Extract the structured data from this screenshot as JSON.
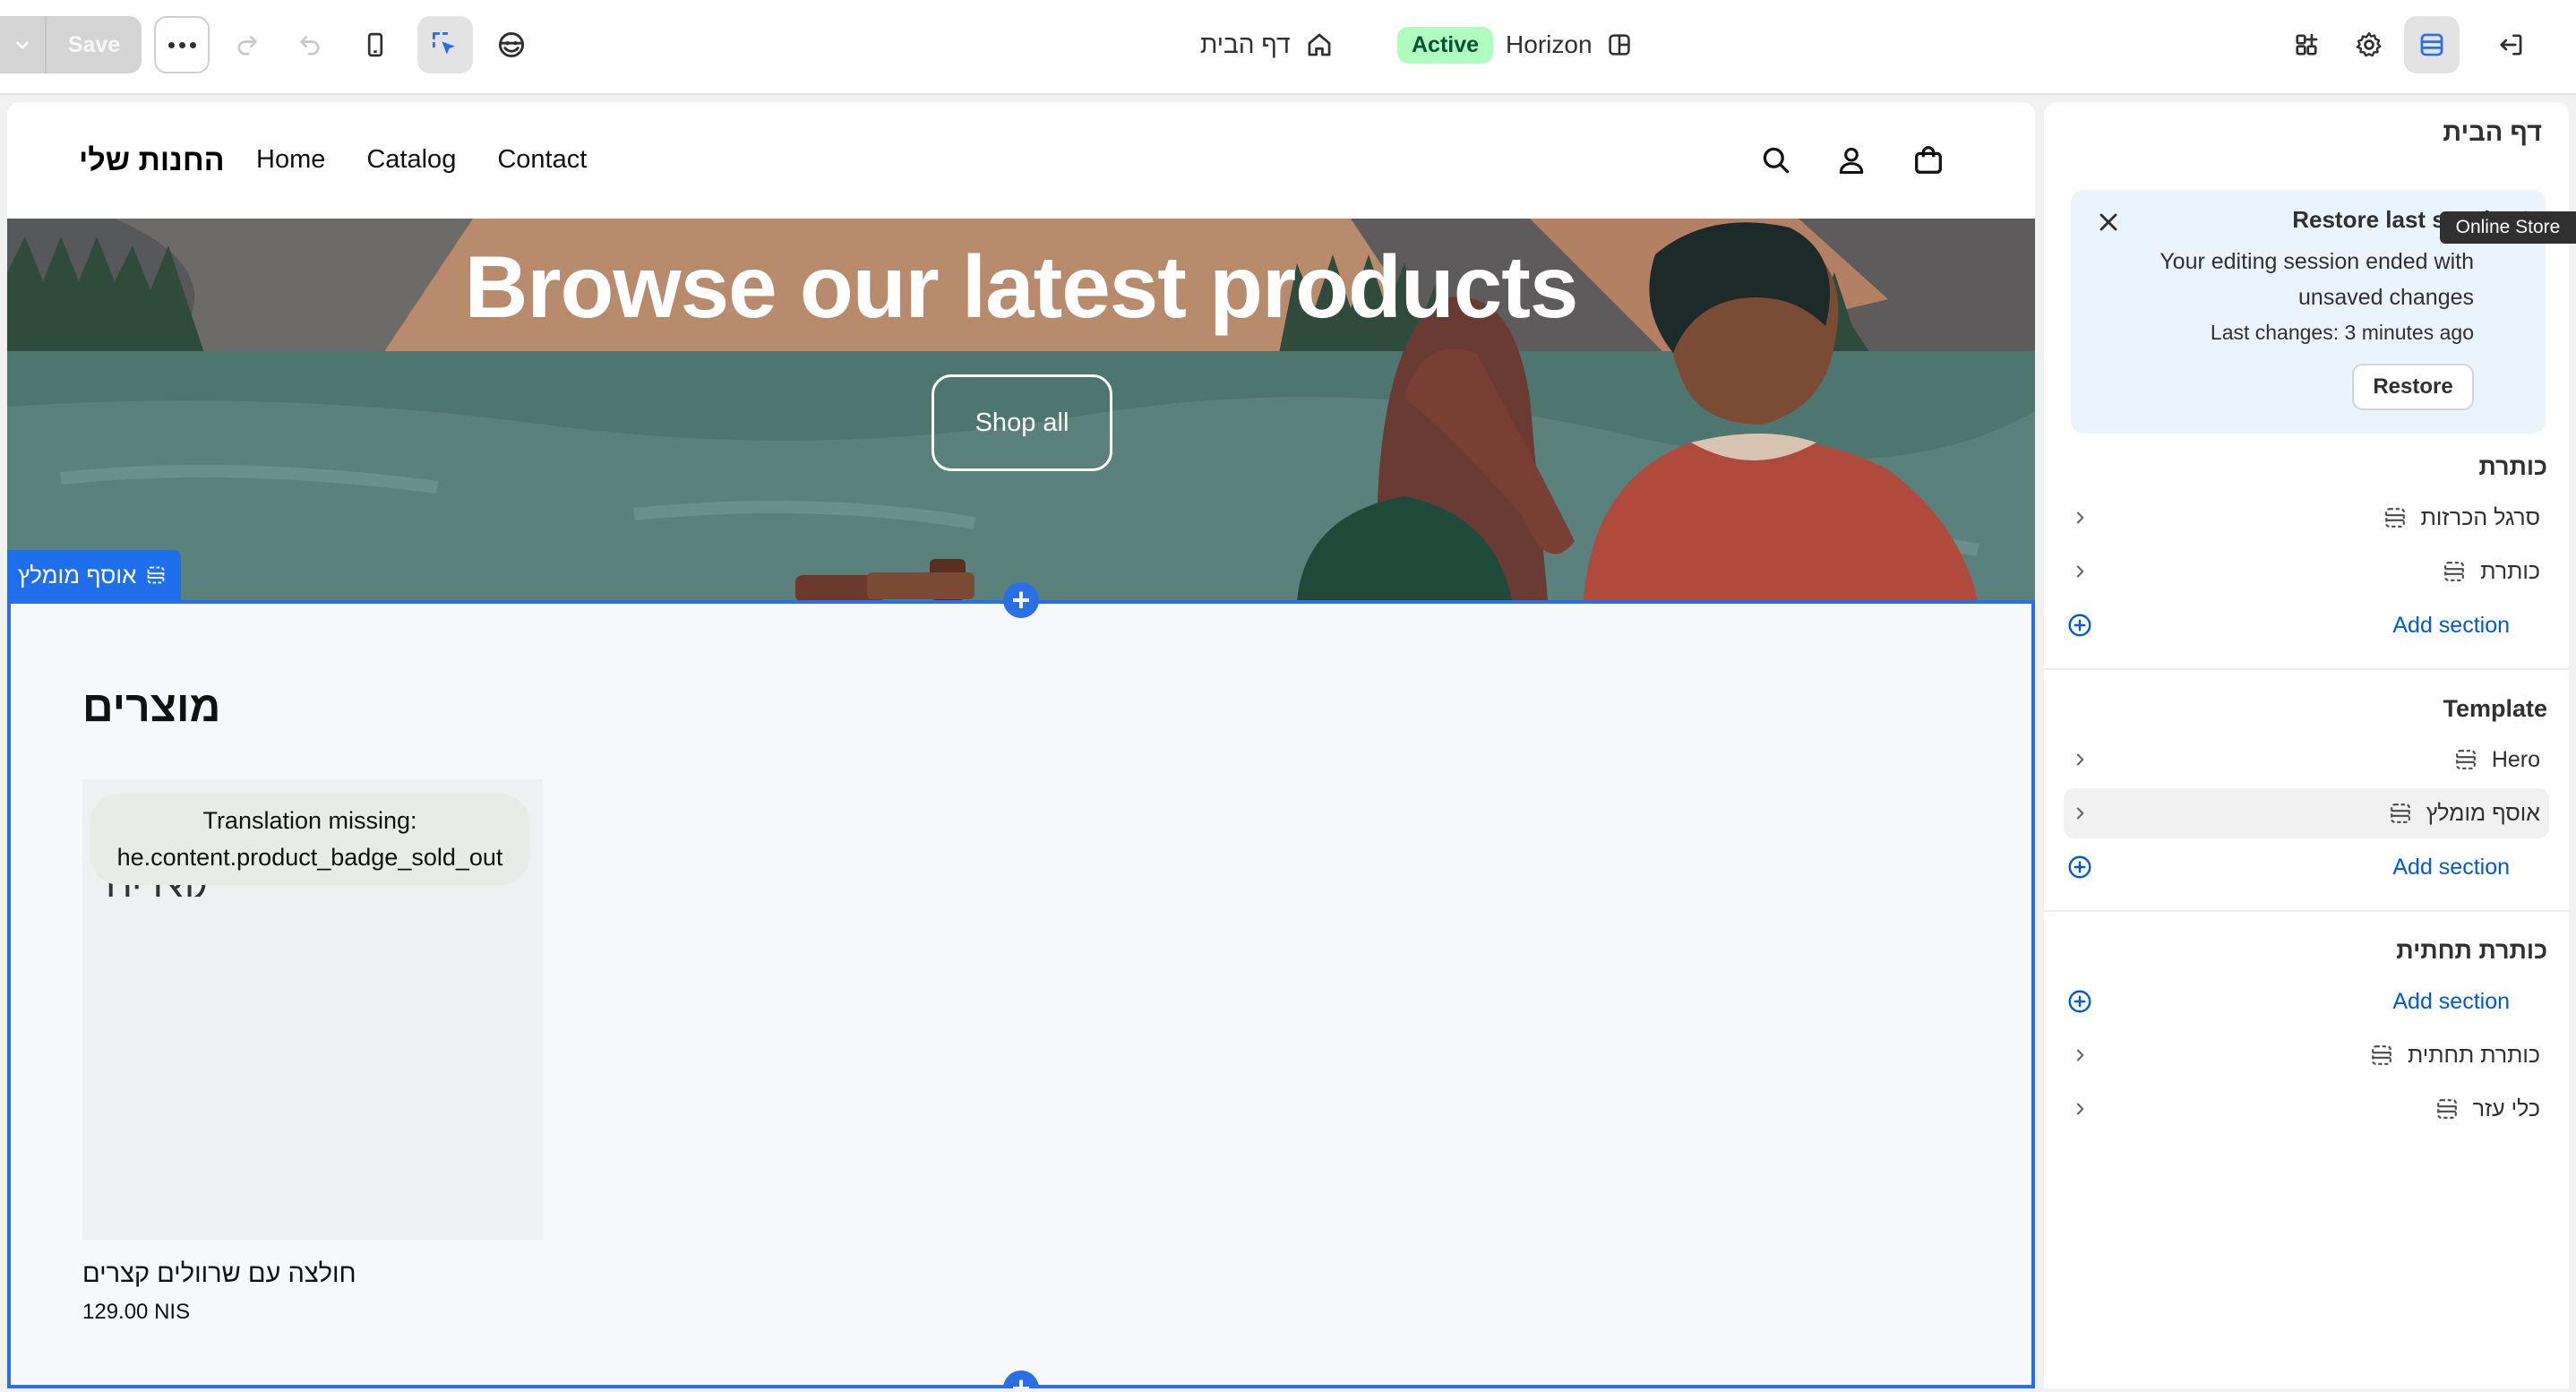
{
  "toolbar": {
    "save_label": "Save",
    "page_title": "דף הבית",
    "theme_status": "Active",
    "theme_name": "Horizon"
  },
  "store": {
    "logo": "החנות שלי",
    "nav": [
      "Home",
      "Catalog",
      "Contact"
    ]
  },
  "hero": {
    "title": "Browse our latest products",
    "button": "Shop all"
  },
  "featured": {
    "tag_label": "אוסף מומלץ",
    "heading": "מוצרים",
    "product": {
      "badge": "Translation missing: he.content.product_badge_sold_out",
      "image_text": "קצרים",
      "title": "חולצה עם שרוולים קצרים",
      "price": "129.00 NIS"
    }
  },
  "sidebar": {
    "title": "דף הבית",
    "restore": {
      "title": "Restore last session?",
      "message": "Your editing session ended with unsaved changes",
      "last_changes": "Last changes: 3 minutes ago",
      "button": "Restore",
      "tooltip": "Online Store"
    },
    "groups": [
      {
        "title": "כותרת",
        "items": [
          "סרגל הכרזות",
          "כותרת"
        ],
        "add": "Add section"
      },
      {
        "title": "Template",
        "items": [
          "Hero",
          "אוסף מומלץ"
        ],
        "add": "Add section"
      },
      {
        "title": "כותרת תחתית",
        "items": [
          "כותרת תחתית",
          "כלי עזר"
        ],
        "add": "Add section"
      }
    ]
  },
  "colors": {
    "accent": "#2b6fe6",
    "active_badge_bg": "#affebf",
    "link": "#005bd3"
  }
}
